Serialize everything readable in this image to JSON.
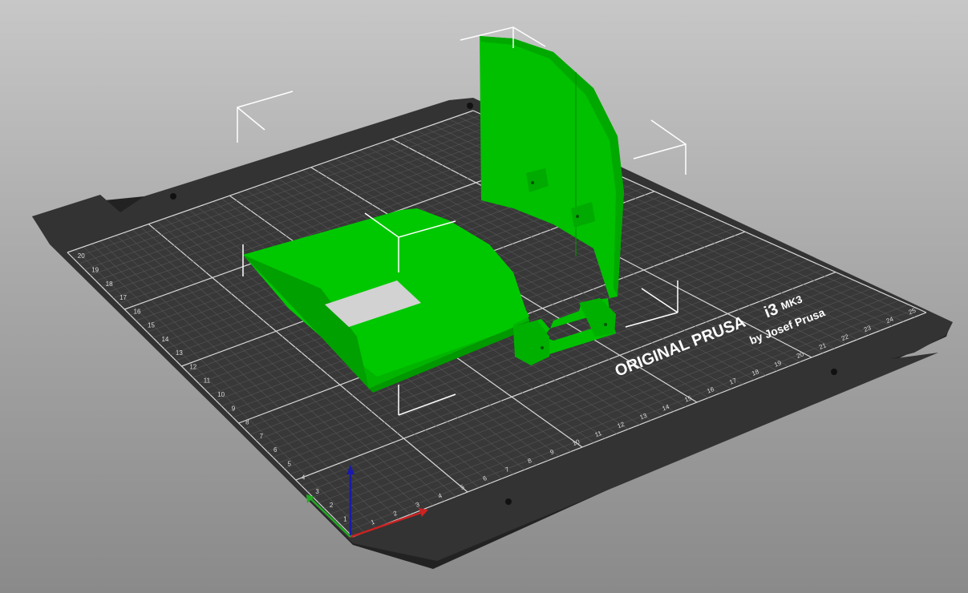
{
  "bed": {
    "brand_line": "ORIGINAL PRUSA",
    "model_line": "i3",
    "model_suffix": "MK3",
    "byline": "by Josef Prusa",
    "x_ticks": [
      "1",
      "2",
      "3",
      "4",
      "5",
      "6",
      "7",
      "8",
      "9",
      "10",
      "11",
      "12",
      "13",
      "14",
      "15",
      "16",
      "17",
      "18",
      "19",
      "20",
      "21",
      "22",
      "23",
      "24",
      "25"
    ],
    "y_ticks": [
      "1",
      "2",
      "3",
      "4",
      "5",
      "6",
      "7",
      "8",
      "9",
      "10",
      "11",
      "12",
      "13",
      "14",
      "15",
      "16",
      "17",
      "18",
      "19",
      "20"
    ]
  },
  "objects": [
    {
      "name": "tray",
      "color": "#00c000",
      "selected": true
    },
    {
      "name": "curved-wall",
      "color": "#00c000",
      "selected": true
    },
    {
      "name": "bracket",
      "color": "#00c000",
      "selected": true
    }
  ],
  "axes": {
    "x_color": "#cc2222",
    "y_color": "#22aa22",
    "z_color": "#1a1aaa"
  }
}
